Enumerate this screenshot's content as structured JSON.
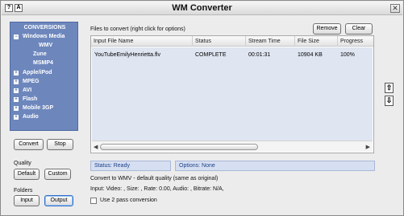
{
  "window": {
    "title": "WM Converter",
    "help_icon_glyph": "?",
    "font_icon_glyph": "A",
    "close_glyph": "✕"
  },
  "sidebar": {
    "tree": [
      {
        "label": "CONVERSIONS",
        "type": "header"
      },
      {
        "label": "Windows Media",
        "type": "group",
        "expanded": true
      },
      {
        "label": "WMV",
        "type": "child"
      },
      {
        "label": "Zune",
        "type": "child"
      },
      {
        "label": "MSMP4",
        "type": "child"
      },
      {
        "label": "Apple/iPod",
        "type": "group",
        "expanded": false
      },
      {
        "label": "MPEG",
        "type": "group",
        "expanded": false
      },
      {
        "label": "AVI",
        "type": "group",
        "expanded": false
      },
      {
        "label": "Flash",
        "type": "group",
        "expanded": false
      },
      {
        "label": "Mobile 3GP",
        "type": "group",
        "expanded": false
      },
      {
        "label": "Audio",
        "type": "group",
        "expanded": false
      }
    ],
    "expanded_glyph": "−",
    "collapsed_glyph": "+",
    "convert_label": "Convert",
    "stop_label": "Stop",
    "quality_label": "Quality",
    "default_label": "Default",
    "custom_label": "Custom",
    "folders_label": "Folders",
    "input_label": "Input",
    "output_label": "Output"
  },
  "main": {
    "files_label": "Files to convert (right click for options)",
    "remove_label": "Remove",
    "clear_label": "Clear",
    "columns": [
      "Input File Name",
      "Status",
      "Stream Time",
      "File Size",
      "Progress"
    ],
    "rows": [
      {
        "file": "YouTubeEmilyHenrietta.flv",
        "status": "COMPLETE",
        "stream_time": "00:01:31",
        "size": "10904 KB",
        "progress": "100%"
      }
    ],
    "scroll_left_glyph": "◀",
    "scroll_right_glyph": "▶",
    "move_up_glyph": "⇧",
    "move_down_glyph": "⇩",
    "status_text": "Status: Ready",
    "options_text": "Options: None",
    "convert_info": "Convert to WMV - default quality (same as original)",
    "input_info": "Input: Video: , Size: , Rate: 0.00, Audio: , Bitrate: N/A,",
    "two_pass_label": "Use 2 pass conversion"
  },
  "colors": {
    "tree_bg": "#6d87bd",
    "list_row_bg": "#dfe5f1",
    "status_bg": "#d6dff2"
  }
}
